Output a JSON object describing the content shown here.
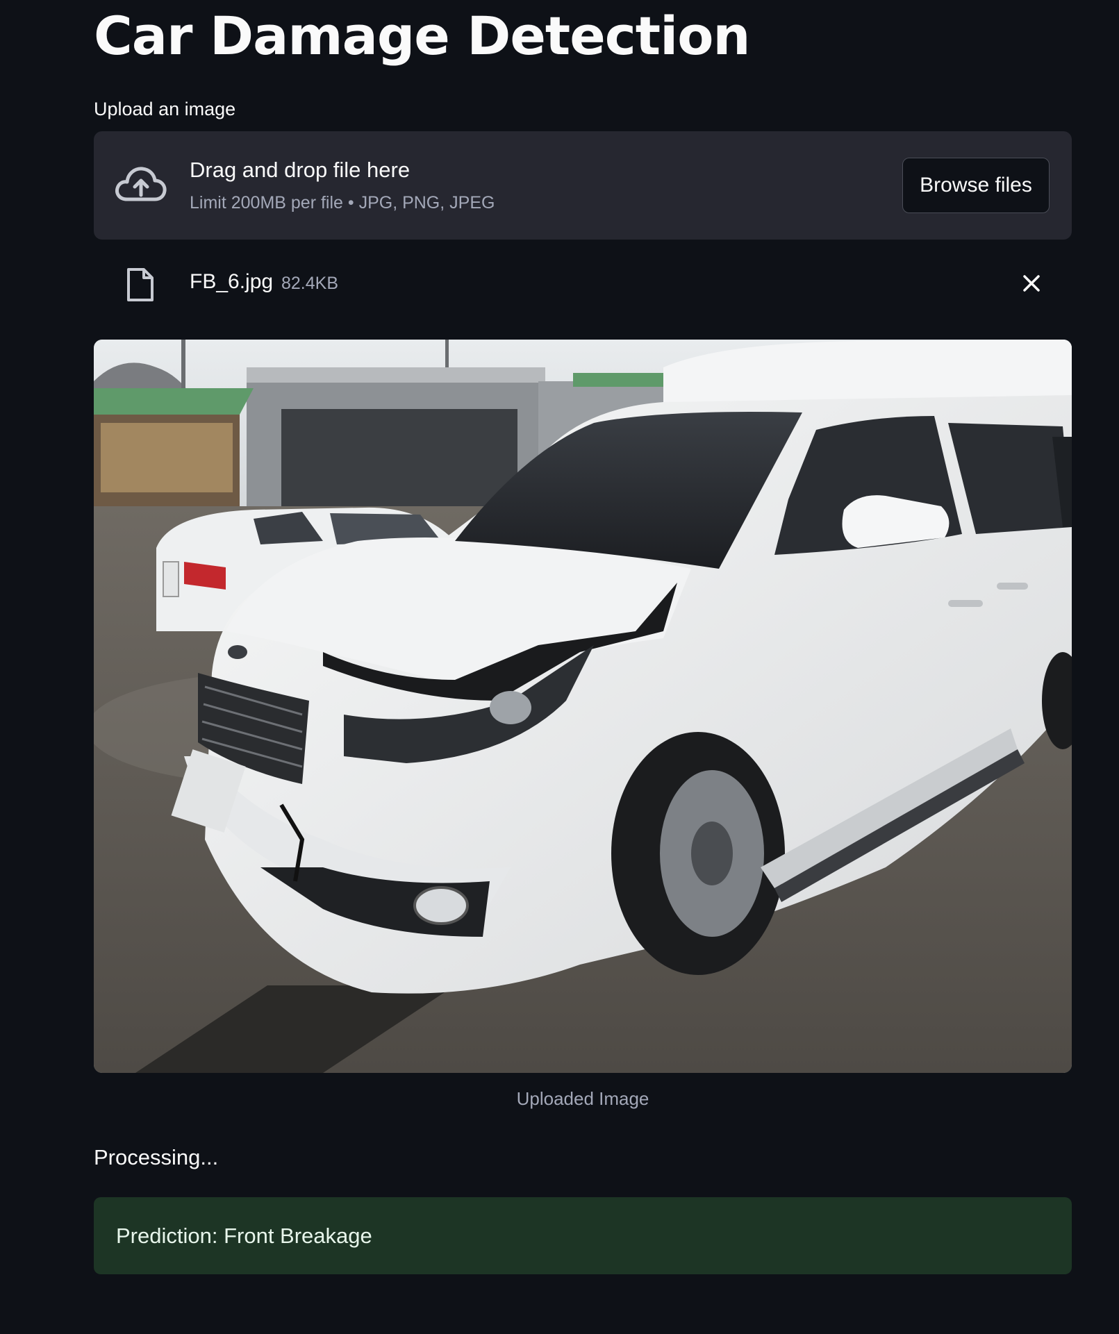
{
  "page": {
    "title": "Car Damage Detection"
  },
  "uploader": {
    "label": "Upload an image",
    "drop_title": "Drag and drop file here",
    "drop_subtitle": "Limit 200MB per file • JPG, PNG, JPEG",
    "browse_label": "Browse files",
    "icon": "cloud-upload-icon"
  },
  "uploaded_file": {
    "name": "FB_6.jpg",
    "size": "82.4KB",
    "icon": "file-icon",
    "remove_icon": "close-icon"
  },
  "image": {
    "caption": "Uploaded Image",
    "alt": "white minivan with damaged front"
  },
  "status": {
    "processing": "Processing..."
  },
  "result": {
    "prediction": "Prediction: Front Breakage"
  },
  "colors": {
    "background": "#0e1117",
    "panel": "#262730",
    "success_bg": "#1d3525",
    "text": "#fafafa",
    "muted": "#a3a8b8"
  }
}
